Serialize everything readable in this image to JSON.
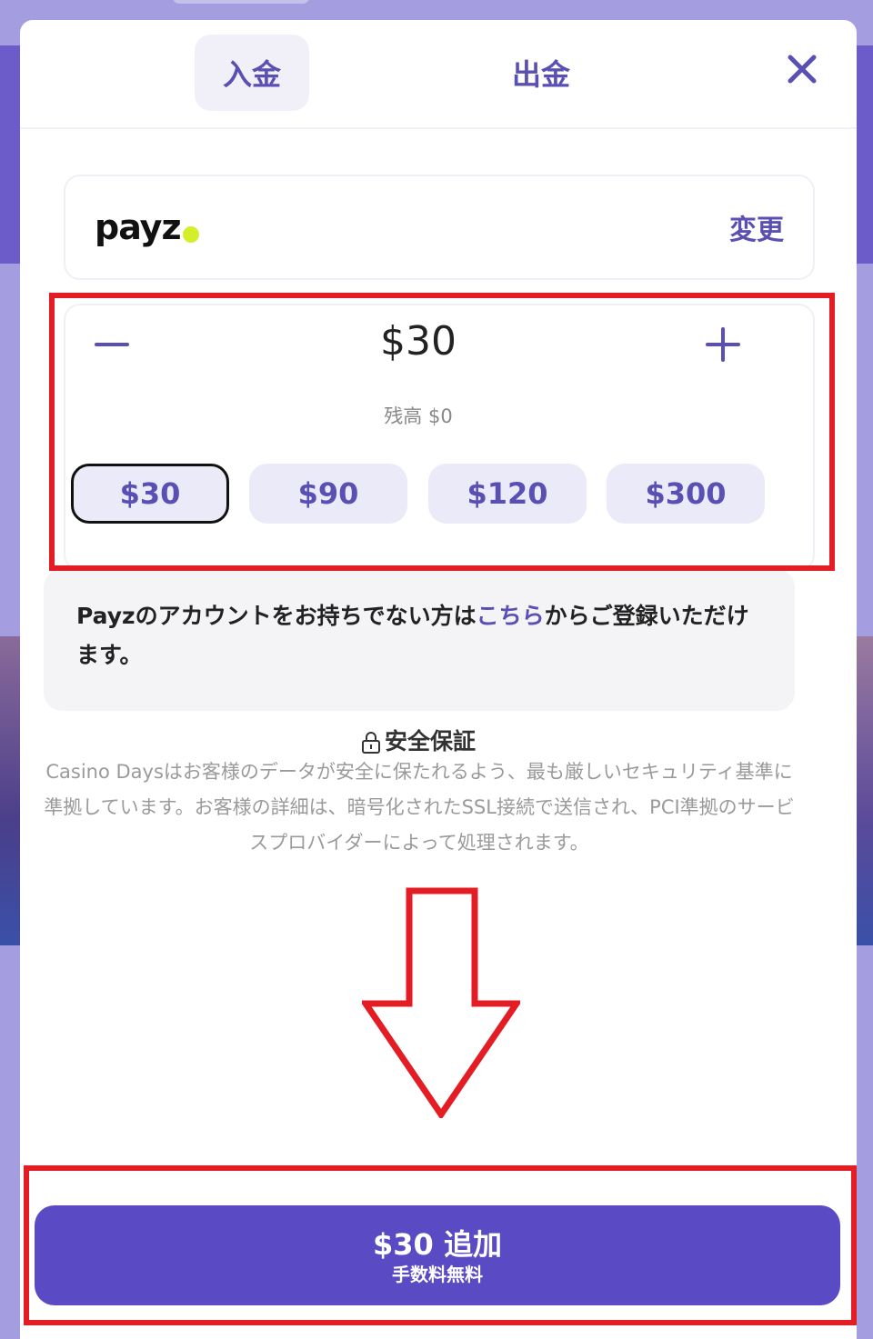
{
  "tabs": {
    "deposit": "入金",
    "withdraw": "出金"
  },
  "payment_method": {
    "name": "payz",
    "change_label": "変更"
  },
  "amount": {
    "value": "$30",
    "balance": "残高 $0"
  },
  "presets": [
    "$30",
    "$90",
    "$120",
    "$300"
  ],
  "info": {
    "text_before": "Payzのアカウントをお持ちでない方は",
    "link": "こちら",
    "text_after": "からご登録いただけます。"
  },
  "security": {
    "title": "安全保証",
    "text": "Casino Daysはお客様のデータが安全に保たれるよう、最も厳しいセキュリティ基準に準拠しています。お客様の詳細は、暗号化されたSSL接続で送信され、PCI準拠のサービスプロバイダーによって処理されます。"
  },
  "cta": {
    "label": "$30 追加",
    "sublabel": "手数料無料"
  },
  "colors": {
    "accent": "#5a4bc4",
    "highlight": "#e41d25",
    "payz_dot": "#d4ef2a"
  }
}
